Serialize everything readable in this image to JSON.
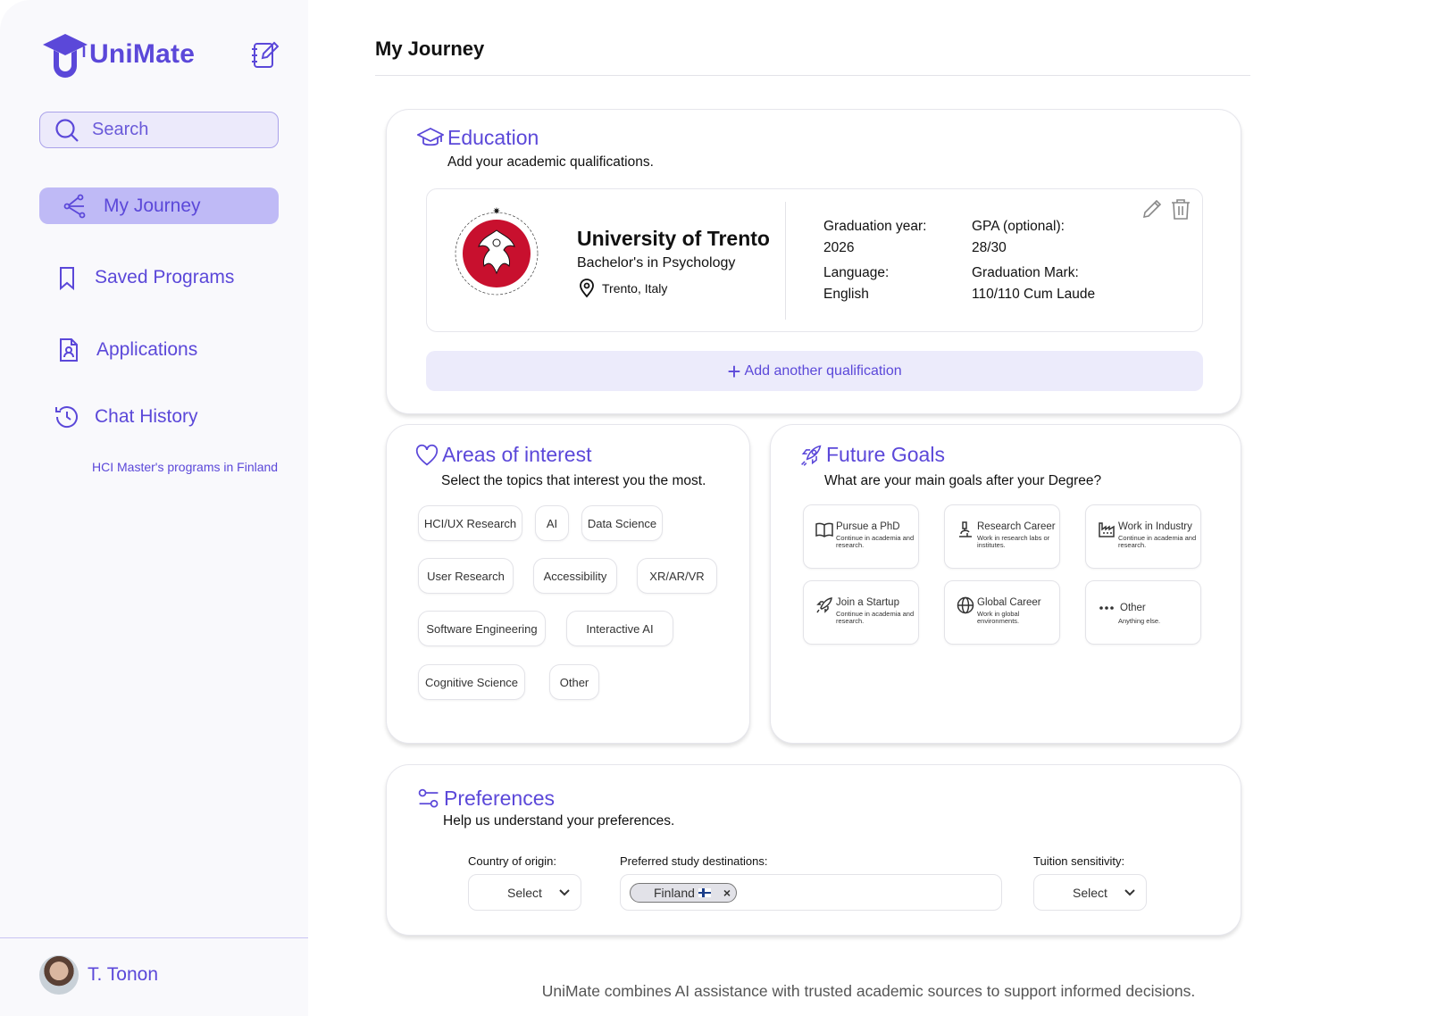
{
  "app": {
    "name": "UniMate"
  },
  "search": {
    "placeholder": "Search"
  },
  "nav": {
    "my_journey": "My Journey",
    "saved_programs": "Saved Programs",
    "applications": "Applications",
    "chat_history": "Chat History",
    "chat_items": [
      "HCI Master's programs in Finland"
    ]
  },
  "user": {
    "name": "T. Tonon"
  },
  "page": {
    "title": "My Journey"
  },
  "education": {
    "title": "Education",
    "subtitle": "Add your academic qualifications.",
    "entry": {
      "university": "University of Trento",
      "degree": "Bachelor's in Psychology",
      "location": "Trento, Italy",
      "graduation_year_label": "Graduation year:",
      "graduation_year": "2026",
      "gpa_label": "GPA (optional):",
      "gpa": "28/30",
      "language_label": "Language:",
      "language": "English",
      "graduation_mark_label": "Graduation Mark:",
      "graduation_mark": "110/110 Cum Laude"
    },
    "add_button": "Add another qualification"
  },
  "interests": {
    "title": "Areas of interest",
    "subtitle": "Select the topics that interest you the most.",
    "chips": [
      "HCI/UX Research",
      "AI",
      "Data Science",
      "User Research",
      "Accessibility",
      "XR/AR/VR",
      "Software Engineering",
      "Interactive AI",
      "Cognitive Science",
      "Other"
    ]
  },
  "goals": {
    "title": "Future Goals",
    "subtitle": "What are your main goals after your Degree?",
    "items": [
      {
        "title": "Pursue a PhD",
        "desc": "Continue in academia and research.",
        "icon": "book-icon"
      },
      {
        "title": "Research Career",
        "desc": "Work in research labs or institutes.",
        "icon": "microscope-icon"
      },
      {
        "title": "Work in Industry",
        "desc": "Continue in academia and research.",
        "icon": "factory-icon"
      },
      {
        "title": "Join a Startup",
        "desc": "Continue in academia and research.",
        "icon": "rocket-icon"
      },
      {
        "title": "Global Career",
        "desc": "Work in global environments.",
        "icon": "globe-icon"
      },
      {
        "title": "Other",
        "desc": "Anything else.",
        "icon": "more-icon"
      }
    ]
  },
  "preferences": {
    "title": "Preferences",
    "subtitle": "Help us understand your preferences.",
    "country_label": "Country of origin:",
    "country_value": "Select",
    "destinations_label": "Preferred study destinations:",
    "destinations": [
      "Finland"
    ],
    "tuition_label": "Tuition sensitivity:",
    "tuition_value": "Select"
  },
  "footer": {
    "note": "UniMate combines AI assistance with trusted academic sources to support informed decisions."
  },
  "colors": {
    "accent": "#5b48d9",
    "active_nav": "#bfbaf6",
    "soft_accent": "#ecebfb"
  }
}
